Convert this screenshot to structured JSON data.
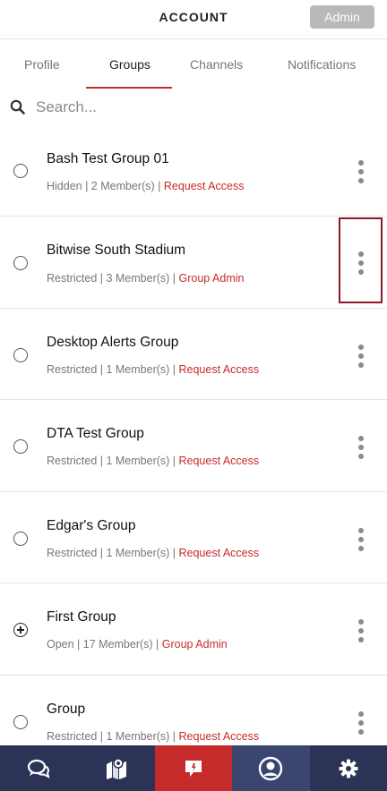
{
  "header": {
    "title": "ACCOUNT",
    "admin_label": "Admin"
  },
  "tabs": [
    {
      "label": "Profile",
      "active": false
    },
    {
      "label": "Groups",
      "active": true
    },
    {
      "label": "Channels",
      "active": false
    },
    {
      "label": "Notifications",
      "active": false
    }
  ],
  "search": {
    "placeholder": "Search...",
    "icon": "search-icon"
  },
  "groups": [
    {
      "name": "Bash Test Group 01",
      "status": "Hidden | 2 Member(s) | ",
      "action": "Request Access",
      "selector": "radio-empty"
    },
    {
      "name": "Bitwise South Stadium",
      "status": "Restricted | 3 Member(s) | ",
      "action": "Group Admin",
      "selector": "radio-empty"
    },
    {
      "name": "Desktop Alerts Group",
      "status": "Restricted | 1 Member(s) | ",
      "action": "Request Access",
      "selector": "radio-empty"
    },
    {
      "name": "DTA Test Group",
      "status": "Restricted | 1 Member(s) | ",
      "action": "Request Access",
      "selector": "radio-empty"
    },
    {
      "name": "Edgar's Group",
      "status": "Restricted | 1 Member(s) | ",
      "action": "Request Access",
      "selector": "radio-empty"
    },
    {
      "name": "First Group",
      "status": "Open | 17 Member(s) | ",
      "action": "Group Admin",
      "selector": "plus"
    },
    {
      "name": "Group",
      "status": "Restricted | 1 Member(s) | ",
      "action": "Request Access",
      "selector": "radio-empty"
    }
  ],
  "bottom_nav": [
    {
      "icon": "chat-icon",
      "state": "default"
    },
    {
      "icon": "map-icon",
      "state": "default"
    },
    {
      "icon": "alert-flag-icon",
      "state": "active-red"
    },
    {
      "icon": "account-icon",
      "state": "active-blue"
    },
    {
      "icon": "settings-gear-icon",
      "state": "default"
    }
  ],
  "colors": {
    "accent": "#c62b2b",
    "nav_bg": "#2b3457",
    "nav_active": "#3a4570",
    "admin_button": "#b9b9b9"
  }
}
